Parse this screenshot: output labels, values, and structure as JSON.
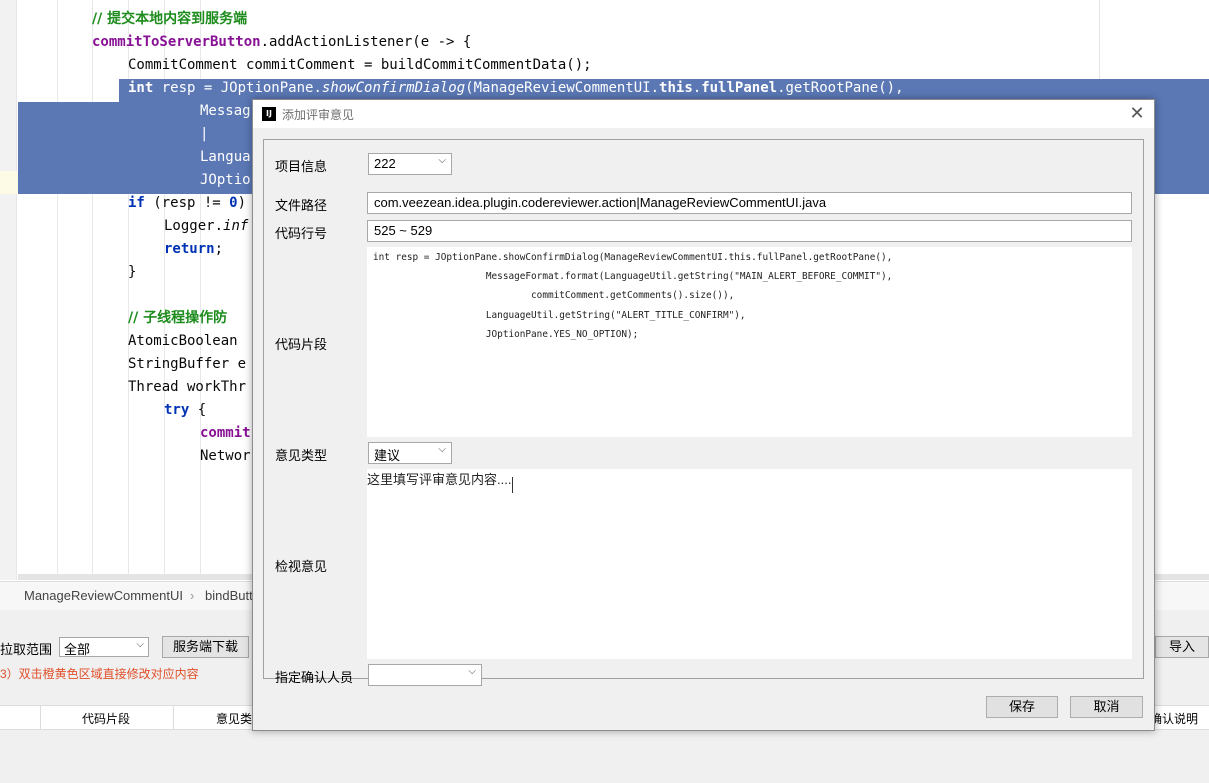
{
  "editor": {
    "lines": [
      {
        "segments": [
          {
            "t": "// 提交本地内容到服务端",
            "c": "cmt"
          }
        ]
      },
      {
        "segments": [
          {
            "t": "commitToServerButton",
            "c": "fld"
          },
          {
            "t": ".addActionListener(e -> {",
            "c": ""
          }
        ]
      },
      {
        "segments": [
          {
            "t": "CommitComment commitComment = buildCommitCommentData();",
            "c": ""
          }
        ]
      },
      {
        "segments": [
          {
            "t": "int",
            "c": "kw"
          },
          {
            "t": " resp = JOptionPane.",
            "c": ""
          },
          {
            "t": "showConfirmDialog",
            "c": "ital"
          },
          {
            "t": "(ManageReviewCommentUI.",
            "c": ""
          },
          {
            "t": "this",
            "c": "kw"
          },
          {
            "t": ".",
            "c": ""
          },
          {
            "t": "fullPanel",
            "c": "fld"
          },
          {
            "t": ".getRootPane(),",
            "c": ""
          }
        ]
      },
      {
        "segments": [
          {
            "t": "Messag",
            "c": ""
          }
        ]
      },
      {
        "segments": [
          {
            "t": "|",
            "c": ""
          }
        ]
      },
      {
        "segments": [
          {
            "t": "Langua",
            "c": ""
          }
        ]
      },
      {
        "segments": [
          {
            "t": "JOptio",
            "c": ""
          }
        ]
      },
      {
        "segments": [
          {
            "t": "if",
            "c": "kw"
          },
          {
            "t": " (resp != ",
            "c": ""
          },
          {
            "t": "0",
            "c": "kw"
          },
          {
            "t": ")",
            "c": ""
          }
        ]
      },
      {
        "segments": [
          {
            "t": "Logger.",
            "c": ""
          },
          {
            "t": "inf",
            "c": "ital"
          }
        ]
      },
      {
        "segments": [
          {
            "t": "return",
            "c": "kw"
          },
          {
            "t": ";",
            "c": ""
          }
        ]
      },
      {
        "segments": [
          {
            "t": "}",
            "c": ""
          }
        ]
      },
      {
        "segments": [
          {
            "t": "",
            "c": ""
          }
        ]
      },
      {
        "segments": [
          {
            "t": "// 子线程操作防",
            "c": "cmt"
          }
        ]
      },
      {
        "segments": [
          {
            "t": "AtomicBoolean",
            "c": ""
          }
        ]
      },
      {
        "segments": [
          {
            "t": "StringBuffer e",
            "c": ""
          }
        ]
      },
      {
        "segments": [
          {
            "t": "Thread workThr",
            "c": ""
          }
        ]
      },
      {
        "segments": [
          {
            "t": "try",
            "c": "kw"
          },
          {
            "t": " {",
            "c": ""
          }
        ]
      },
      {
        "segments": [
          {
            "t": "commit",
            "c": "fld"
          }
        ]
      },
      {
        "segments": [
          {
            "t": "Networ",
            "c": ""
          }
        ]
      }
    ]
  },
  "breadcrumb": {
    "item1": "ManageReviewCommentUI",
    "item2": "bindButt"
  },
  "bottom_panel": {
    "range_label": "拉取范围",
    "range_value": "全部",
    "server_download": "服务端下载",
    "import": "导入",
    "hint": "3）双击橙黄色区域直接修改对应内容",
    "columns": [
      "代码片段",
      "意见类",
      "确认说明"
    ]
  },
  "dialog": {
    "title": "添加评审意见",
    "project_label": "项目信息",
    "project_value": "222",
    "path_label": "文件路径",
    "path_value": "com.veezean.idea.plugin.codereviewer.action|ManageReviewCommentUI.java",
    "line_label": "代码行号",
    "line_value": "525 ~ 529",
    "snippet_label": "代码片段",
    "snippet_value": "int resp = JOptionPane.showConfirmDialog(ManageReviewCommentUI.this.fullPanel.getRootPane(),\n                    MessageFormat.format(LanguageUtil.getString(\"MAIN_ALERT_BEFORE_COMMIT\"),\n                            commitComment.getComments().size()),\n                    LanguageUtil.getString(\"ALERT_TITLE_CONFIRM\"),\n                    JOptionPane.YES_NO_OPTION);",
    "type_label": "意见类型",
    "type_value": "建议",
    "comment_label": "检视意见",
    "comment_placeholder": "这里填写评审意见内容....",
    "confirmer_label": "指定确认人员",
    "confirmer_value": "",
    "save": "保存",
    "cancel": "取消"
  }
}
